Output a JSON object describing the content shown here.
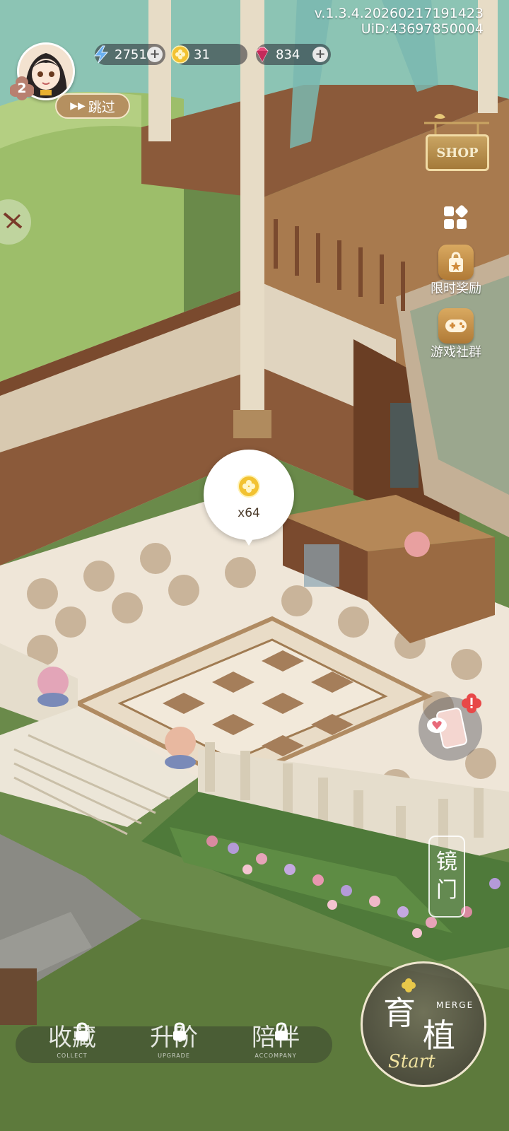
{
  "version": {
    "build": "v.1.3.4.20260217191423",
    "uid": "UiD:43697850004"
  },
  "player": {
    "level": "2"
  },
  "skip_button": {
    "label": "跳过"
  },
  "resources": [
    {
      "name": "energy",
      "icon": "lightning-icon",
      "value": "2751"
    },
    {
      "name": "coin",
      "icon": "clover-coin-icon",
      "value": "31"
    },
    {
      "name": "gem",
      "icon": "diamond-icon",
      "value": "834"
    }
  ],
  "shop": {
    "label": "SHOP"
  },
  "side_menu": {
    "limited_reward": "限时奖励",
    "game_community": "游戏社群"
  },
  "reward_bubble": {
    "count": "x64"
  },
  "mirror_gate": {
    "line1": "镜",
    "line2": "门"
  },
  "bottom_nav": [
    {
      "label": "收藏",
      "sub": "COLLECT"
    },
    {
      "label": "升阶",
      "sub": "UPGRADE"
    },
    {
      "label": "陪伴",
      "sub": "ACCOMPANY"
    }
  ],
  "merge_button": {
    "tag": "MERGE",
    "title": "育植",
    "script": "Start"
  },
  "colors": {
    "wood": "#8b5a3a",
    "floor_light": "#efe6d8",
    "floor_dark": "#c9b49a",
    "lawn": "#6f9a48",
    "gold": "#c9a462"
  }
}
